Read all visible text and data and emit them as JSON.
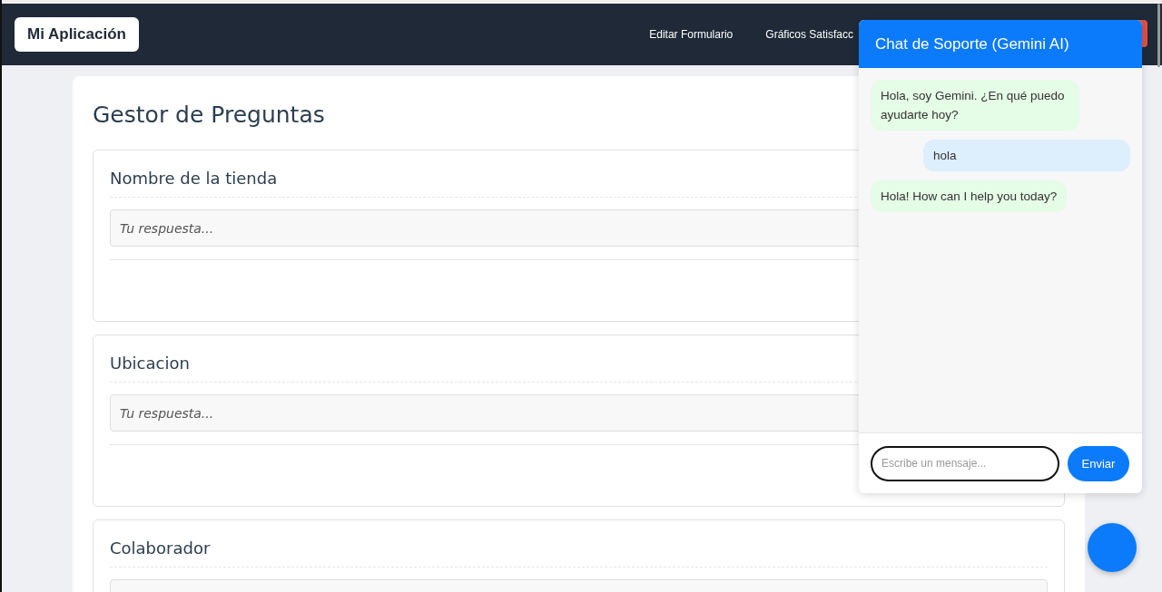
{
  "navbar": {
    "brand": "Mi Aplicación",
    "links": [
      "Editar Formulario",
      "Gráficos Satisfacc"
    ]
  },
  "page": {
    "title": "Gestor de Preguntas",
    "questions": [
      {
        "label": "Nombre de la tienda",
        "placeholder": "Tu respuesta..."
      },
      {
        "label": "Ubicacion",
        "placeholder": "Tu respuesta..."
      },
      {
        "label": "Colaborador"
      }
    ]
  },
  "chat": {
    "title": "Chat de Soporte (Gemini AI)",
    "messages": [
      {
        "kind": "bot",
        "text": "Hola, soy Gemini. ¿En qué puedo ayudarte hoy?"
      },
      {
        "kind": "user",
        "text": "hola"
      },
      {
        "kind": "bot",
        "text": "Hola! How can I help you today?"
      }
    ],
    "input": {
      "placeholder": "Escribe un mensaje..."
    },
    "send_button": "Enviar"
  }
}
